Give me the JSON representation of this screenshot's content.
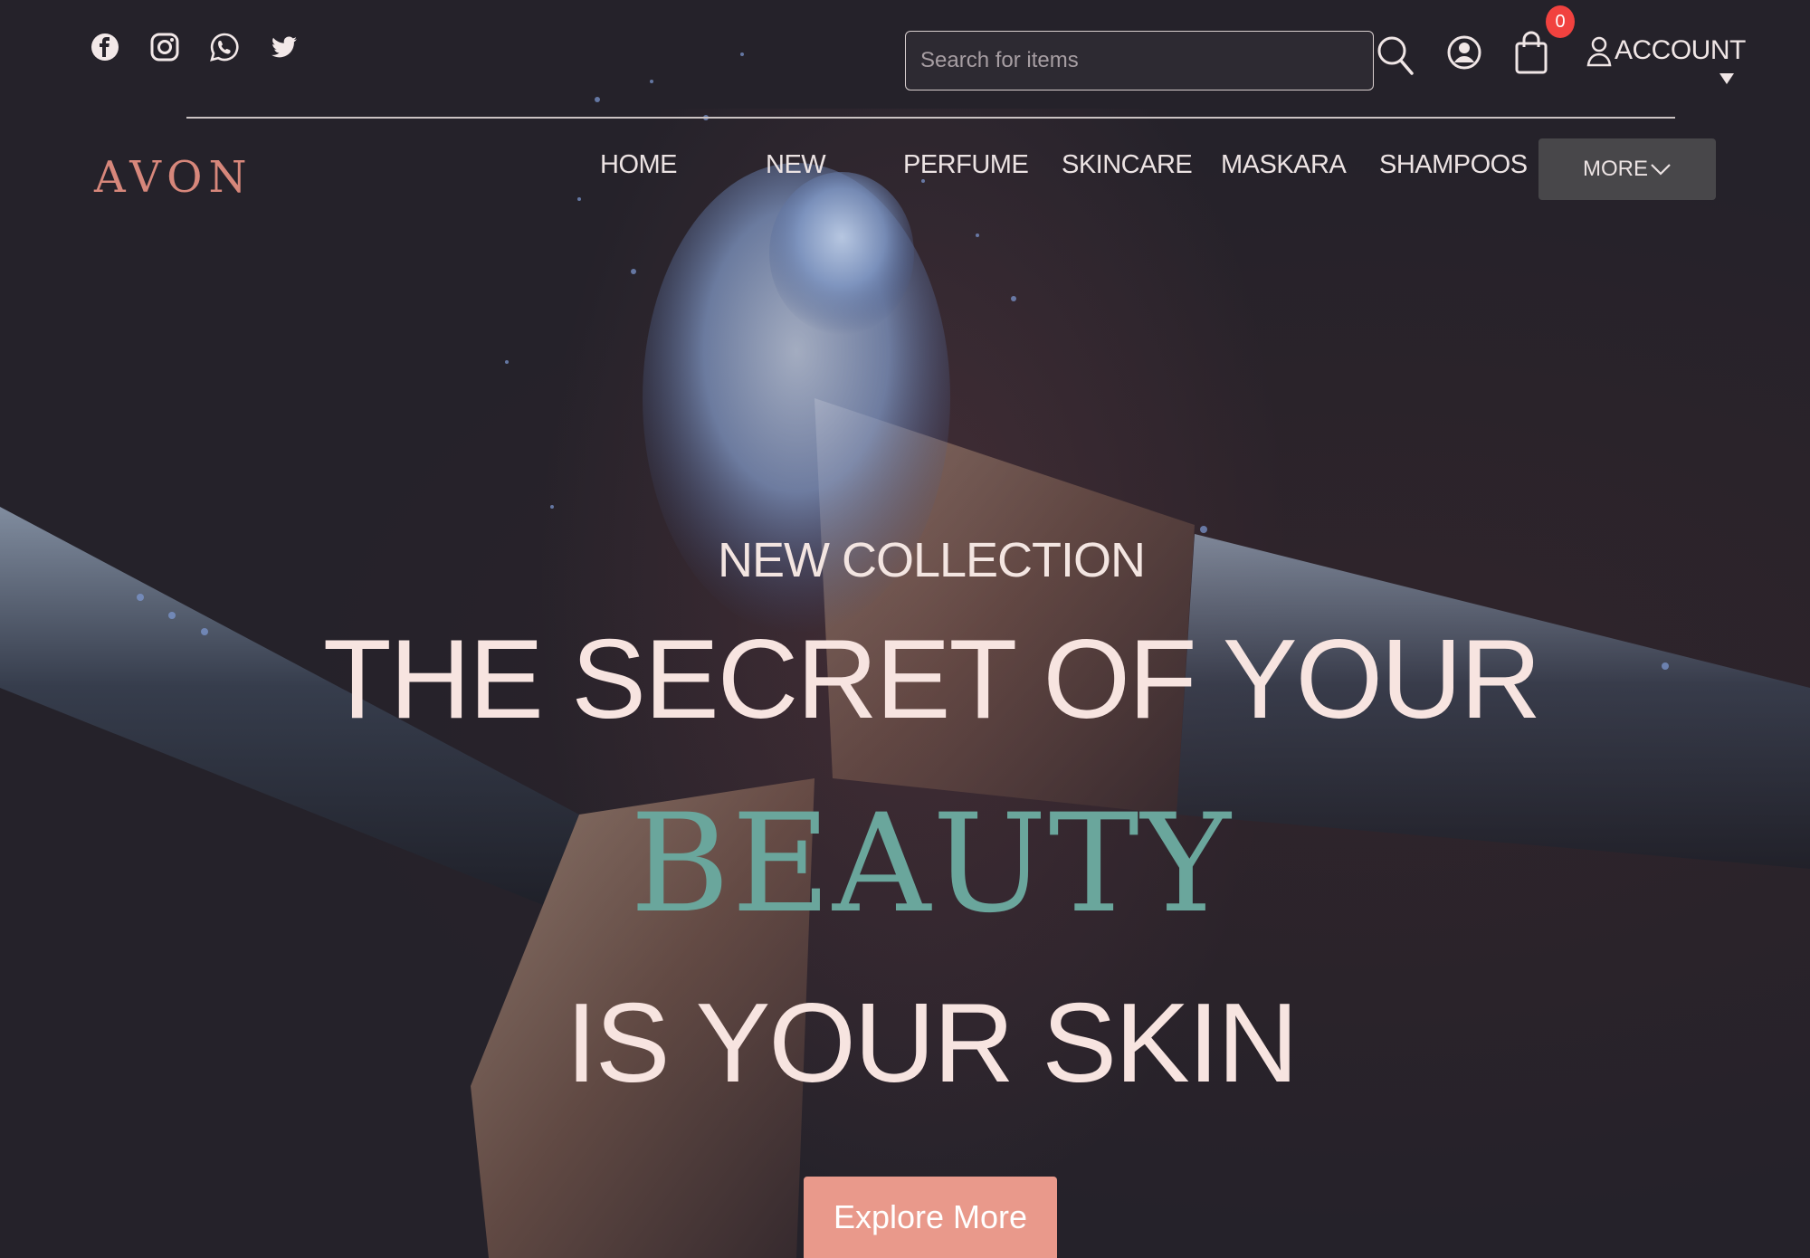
{
  "social": {
    "icons": [
      "facebook-icon",
      "instagram-icon",
      "whatsapp-icon",
      "twitter-icon"
    ]
  },
  "search": {
    "placeholder": "Search for items"
  },
  "header": {
    "cart_count": "0",
    "account_label": "ACCOUNT"
  },
  "brand": {
    "logo": "AVON"
  },
  "nav": {
    "items": [
      "HOME",
      "NEW",
      "PERFUME",
      "SKINCARE",
      "MASKARA",
      "SHAMPOOS"
    ],
    "more_label": "MORE"
  },
  "hero": {
    "kicker": "NEW COLLECTION",
    "line1": "THE SECRET OF YOUR",
    "highlight": "BEAUTY",
    "line3": "IS YOUR SKIN",
    "cta": "Explore More"
  },
  "colors": {
    "background": "#25222a",
    "logo": "#d7877b",
    "highlight": "#6aa69c",
    "cta": "#e9998b",
    "badge": "#f1423f"
  }
}
